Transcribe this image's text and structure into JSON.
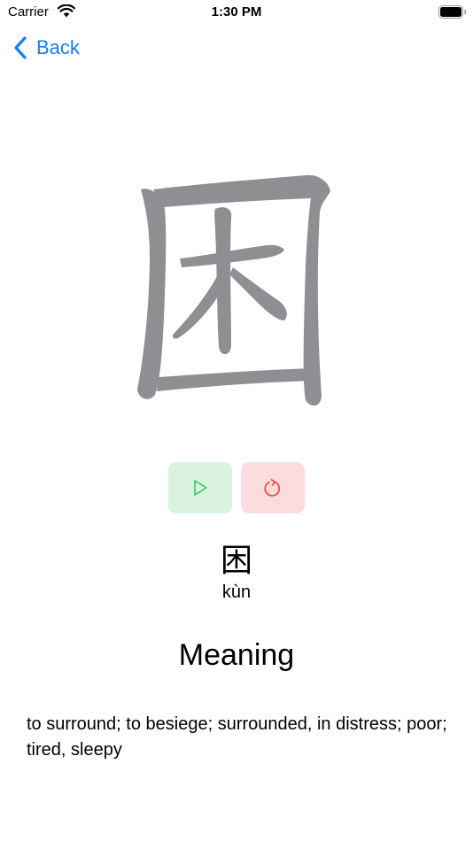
{
  "status_bar": {
    "carrier": "Carrier",
    "time": "1:30 PM"
  },
  "nav": {
    "back_label": "Back"
  },
  "character": {
    "glyph": "困",
    "pinyin": "kùn"
  },
  "meaning": {
    "heading": "Meaning",
    "text": "to surround; to besiege; surrounded, in distress; poor; tired, sleepy"
  },
  "controls": {
    "play_icon": "play-icon",
    "reset_icon": "reset-icon"
  },
  "colors": {
    "accent": "#1a7cf5",
    "stroke": "#8e8e93",
    "play_bg": "#d9f3df",
    "play_fg": "#34c759",
    "reset_bg": "#fcdcdc",
    "reset_fg": "#ff3b30"
  }
}
